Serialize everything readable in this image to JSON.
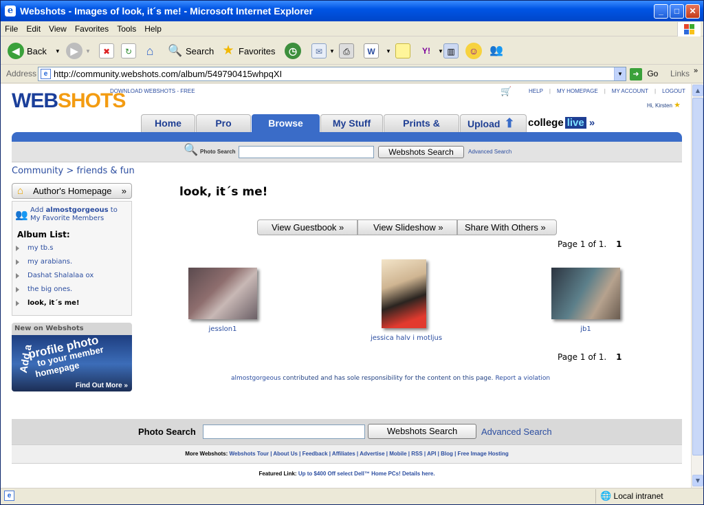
{
  "window": {
    "title": "Webshots - Images of look, it´s me! - Microsoft Internet Explorer"
  },
  "menu": [
    "File",
    "Edit",
    "View",
    "Favorites",
    "Tools",
    "Help"
  ],
  "toolbar": {
    "back": "Back",
    "search": "Search",
    "favorites": "Favorites"
  },
  "address": {
    "label": "Address",
    "url": "http://community.webshots.com/album/549790415whpqXI",
    "go": "Go",
    "links": "Links"
  },
  "page": {
    "logo_part1": "WEB",
    "logo_part2": "SHOTS",
    "download": "DOWNLOAD WEBSHOTS - FREE",
    "top_links": [
      "HELP",
      "MY HOMEPAGE",
      "MY ACCOUNT",
      "LOGOUT"
    ],
    "greeting": "Hi, Kirsten",
    "tabs": [
      "Home",
      "Pro Shots",
      "Browse",
      "My Stuff",
      "Prints & Gifts",
      "Upload"
    ],
    "college": "college",
    "live": "live",
    "photo_search_label": "Photo Search",
    "search_button": "Webshots Search",
    "advanced_search": "Advanced Search",
    "breadcrumb_community": "Community",
    "breadcrumb_sep": ">",
    "breadcrumb_category": "friends & fun",
    "author_homepage": "Author's Homepage",
    "add_text_1": "Add",
    "add_user": "almostgorgeous",
    "add_text_2": "to My Favorite Members",
    "album_list_title": "Album List:",
    "albums": [
      "my tb.s",
      "my arabians.",
      "Dashat Shalalaa ox",
      "the big ones.",
      "look, it´s me!"
    ],
    "new_on_webshots": "New on Webshots",
    "promo_add": "Add a",
    "promo_profile": "profile photo",
    "promo_to": "to your member",
    "promo_homepage": "homepage",
    "find_out_more": "Find Out More",
    "album_title": "look, it´s me!",
    "actions": [
      "View Guestbook",
      "View Slideshow",
      "Share With Others"
    ],
    "page_info": "Page 1 of 1.",
    "page_current": "1",
    "photos": [
      "jesslon1",
      "jessica halv i motljus",
      "jb1"
    ],
    "contrib_user": "almostgorgeous",
    "contrib_text": "contributed and has sole responsibility for the content on this page.",
    "report": "Report a violation",
    "footer_search_label": "Photo Search",
    "more_label": "More Webshots:",
    "more_links": "Webshots Tour | About Us | Feedback | Affiliates | Advertise | Mobile | RSS | API | Blog | Free Image Hosting",
    "featured_label": "Featured Link:",
    "featured_text": "Up to $400 Off select Dell™ Home PCs! Details here."
  },
  "status": {
    "zone": "Local intranet"
  }
}
